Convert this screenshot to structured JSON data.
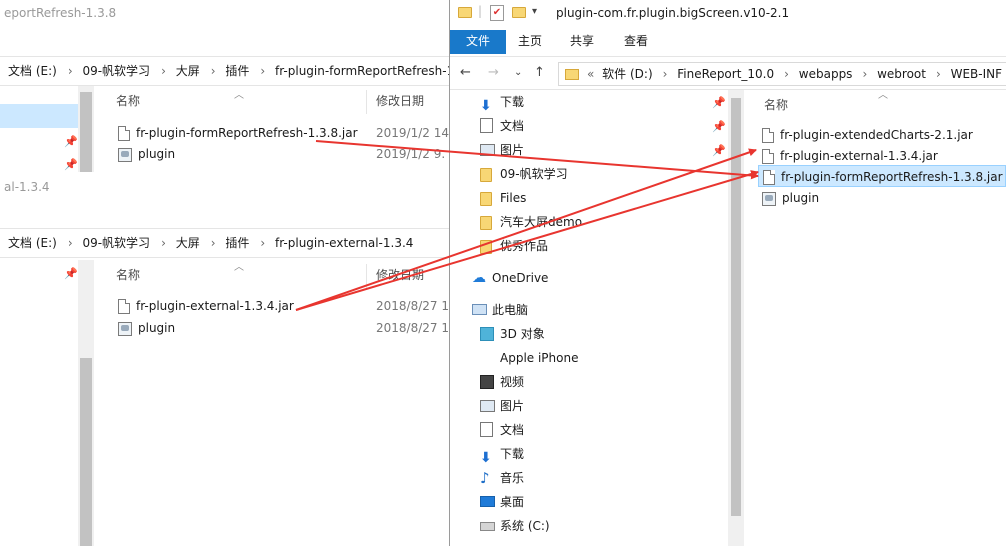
{
  "bg_window_1": {
    "title": "eportRefresh-1.3.8",
    "breadcrumb": [
      "文档 (E:)",
      "09-帆软学习",
      "大屏",
      "插件",
      "fr-plugin-formReportRefresh-1"
    ],
    "columns": {
      "name": "名称",
      "modified": "修改日期"
    },
    "files": [
      {
        "name": "fr-plugin-formReportRefresh-1.3.8.jar",
        "date": "2019/1/2 14",
        "icon": "file-icon"
      },
      {
        "name": "plugin",
        "date": "2019/1/2 9.",
        "icon": "plugin-file-icon"
      }
    ]
  },
  "bg_window_2": {
    "title": "al-1.3.4",
    "breadcrumb": [
      "文档 (E:)",
      "09-帆软学习",
      "大屏",
      "插件",
      "fr-plugin-external-1.3.4"
    ],
    "columns": {
      "name": "名称",
      "modified": "修改日期"
    },
    "files": [
      {
        "name": "fr-plugin-external-1.3.4.jar",
        "date": "2018/8/27 1",
        "icon": "file-icon"
      },
      {
        "name": "plugin",
        "date": "2018/8/27 1",
        "icon": "plugin-file-icon"
      }
    ]
  },
  "front_window": {
    "title": "plugin-com.fr.plugin.bigScreen.v10-2.1",
    "ribbon_tabs": [
      "文件",
      "主页",
      "共享",
      "查看"
    ],
    "address": {
      "prefix": "«",
      "crumbs": [
        "软件 (D:)",
        "FineReport_10.0",
        "webapps",
        "webroot",
        "WEB-INF"
      ]
    },
    "nav_items": [
      {
        "label": "下载",
        "icon": "download-icon",
        "pinned": true
      },
      {
        "label": "文档",
        "icon": "document-icon",
        "pinned": true
      },
      {
        "label": "图片",
        "icon": "pictures-icon",
        "pinned": true
      },
      {
        "label": "09-帆软学习",
        "icon": "folder-icon",
        "pinned": false
      },
      {
        "label": "Files",
        "icon": "folder-icon",
        "pinned": false
      },
      {
        "label": "汽车大屏demo",
        "icon": "folder-icon",
        "pinned": false
      },
      {
        "label": "优秀作品",
        "icon": "folder-icon",
        "pinned": false
      },
      {
        "label": "OneDrive",
        "icon": "onedrive-cloud-icon",
        "pinned": false
      },
      {
        "label": "此电脑",
        "icon": "this-pc-icon",
        "pinned": false
      },
      {
        "label": "3D 对象",
        "icon": "3d-objects-icon",
        "pinned": false
      },
      {
        "label": "Apple iPhone",
        "icon": "iphone-icon",
        "pinned": false
      },
      {
        "label": "视频",
        "icon": "video-icon",
        "pinned": false
      },
      {
        "label": "图片",
        "icon": "pictures-icon",
        "pinned": false
      },
      {
        "label": "文档",
        "icon": "document-icon",
        "pinned": false
      },
      {
        "label": "下载",
        "icon": "download-icon",
        "pinned": false
      },
      {
        "label": "音乐",
        "icon": "music-icon",
        "pinned": false
      },
      {
        "label": "桌面",
        "icon": "desktop-icon",
        "pinned": false
      },
      {
        "label": "系统 (C:)",
        "icon": "drive-icon",
        "pinned": false
      }
    ],
    "columns": {
      "name": "名称"
    },
    "files": [
      {
        "name": "fr-plugin-extendedCharts-2.1.jar",
        "icon": "file-icon",
        "selected": false
      },
      {
        "name": "fr-plugin-external-1.3.4.jar",
        "icon": "file-icon",
        "selected": false
      },
      {
        "name": "fr-plugin-formReportRefresh-1.3.8.jar",
        "icon": "file-icon",
        "selected": true
      },
      {
        "name": "plugin",
        "icon": "plugin-file-icon",
        "selected": false
      }
    ]
  },
  "annotation_color": "#e8352f"
}
